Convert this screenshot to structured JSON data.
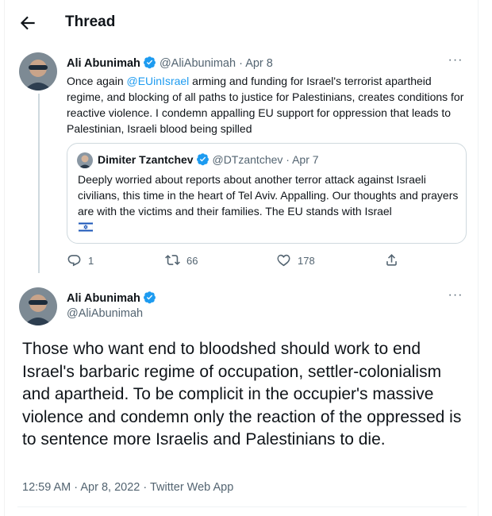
{
  "header": {
    "title": "Thread"
  },
  "tweet1": {
    "author_name": "Ali Abunimah",
    "handle": "@AliAbunimah",
    "separator": "·",
    "date": "Apr 8",
    "text_before_mention": "Once again ",
    "mention": "@EUinIsrael",
    "text_after_mention": " arming and funding for Israel's terrorist apartheid regime, and blocking of all paths to justice for Palestinians, creates conditions for reactive violence. I condemn appalling EU support for oppression that leads to Palestinian, Israeli blood being spilled",
    "quote": {
      "author_name": "Dimiter Tzantchev",
      "handle": "@DTzantchev",
      "separator": "·",
      "date": "Apr 7",
      "text": "Deeply worried about reports about another terror attack against Israeli civilians, this time in the heart of Tel Aviv. Appalling. Our thoughts and prayers are with the victims and their families. The EU stands with Israel",
      "flag_icon": "israel-flag-icon"
    },
    "actions": {
      "replies": "1",
      "retweets": "66",
      "likes": "178"
    }
  },
  "tweet2": {
    "author_name": "Ali Abunimah",
    "handle": "@AliAbunimah",
    "text": "Those who want end to bloodshed should work to end Israel's barbaric regime of occupation, settler-colonialism and apartheid. To be complicit in the occupier's massive violence and condemn only the reaction of the oppressed is to sentence more Israelis and Palestinians to die.",
    "meta": "12:59 AM · Apr 8, 2022 · Twitter Web App"
  },
  "colors": {
    "accent": "#1d9bf0",
    "muted": "#536471",
    "border": "#cfd9de"
  }
}
